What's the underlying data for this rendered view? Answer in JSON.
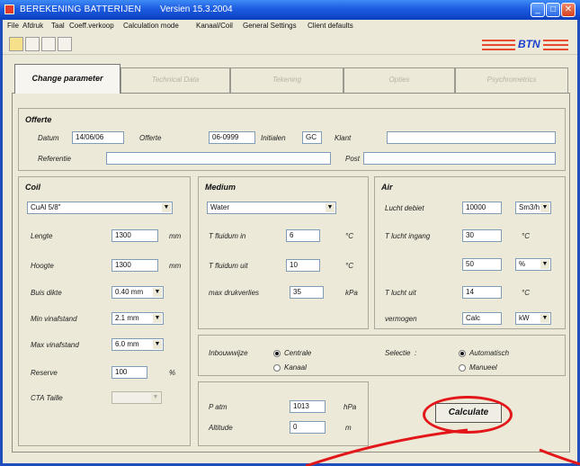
{
  "window": {
    "title": "BEREKENING BATTERIJEN",
    "version": "Versien 15.3.2004",
    "btn_min": "_",
    "btn_max": "□",
    "btn_close": "✕"
  },
  "menu": [
    "File",
    "Afdruk",
    "Taal",
    "Coeff.verkoop",
    "Calculation mode",
    "Kanaal/Coil",
    "General Settings",
    "Client defaults"
  ],
  "logo": "BTN",
  "tabs": [
    "Change parameter",
    "Technical Data",
    "Tekening",
    "Opties",
    "Psychrometrics"
  ],
  "offerte": {
    "title": "Offerte",
    "datum_label": "Datum",
    "datum_value": "14/06/06",
    "offerte_label": "Offerte",
    "offerte_value": "06-0999",
    "initialen_label": "Initialen",
    "initialen_value": "GC",
    "klant_label": "Klant",
    "klant_value": "",
    "referentie_label": "Referentie",
    "referentie_value": "",
    "post_label": "Post",
    "post_value": ""
  },
  "coil": {
    "title": "Coil",
    "type_value": "CuAl 5/8\"",
    "lengte_label": "Lengte",
    "lengte_value": "1300",
    "lengte_unit": "mm",
    "hoogte_label": "Hoogte",
    "hoogte_value": "1300",
    "hoogte_unit": "mm",
    "buis_label": "Buis dikte",
    "buis_value": "0.40 mm",
    "vin_label": "Min vinafstand",
    "vin_value": "2.1 mm",
    "max_label": "Max vinafstand",
    "max_value": "6.0 mm",
    "reserve_label": "Reserve",
    "reserve_value": "100",
    "reserve_unit": "%",
    "cta_label": "CTA Taille",
    "cta_value": ""
  },
  "medium": {
    "title": "Medium",
    "type_value": "Water",
    "tin_label": "T fluidum in",
    "tin_value": "6",
    "tin_unit": "°C",
    "tout_label": "T fluidum uit",
    "tout_value": "10",
    "tout_unit": "°C",
    "dp_label": "max drukverlies",
    "dp_value": "35",
    "dp_unit": "kPa"
  },
  "air": {
    "title": "Air",
    "debiet_label": "Lucht debiet",
    "debiet_value": "10000",
    "debiet_unit": "Sm3/h",
    "tin_label": "T lucht ingang",
    "tin_value": "30",
    "tin_unit": "°C",
    "rh_value": "50",
    "rh_unit": "%",
    "tout_label": "T lucht uit",
    "tout_value": "14",
    "tout_unit": "°C",
    "verm_label": "vermogen",
    "verm_value": "Calc",
    "verm_unit": "kW"
  },
  "inbouw": {
    "label": "Inbouwwijze",
    "opt1": "Centrale",
    "opt2": "Kanaal",
    "selected": "Centrale"
  },
  "selectie": {
    "label": "Selectie",
    "opt1": "Automatisch",
    "opt2": "Manueel",
    "selected": "Automatisch"
  },
  "ambient": {
    "patm_label": "P atm",
    "patm_value": "1013",
    "patm_unit": "hPa",
    "alt_label": "Altitude",
    "alt_value": "0",
    "alt_unit": "m"
  },
  "calculate_label": "Calculate",
  "colors": {
    "title_blue": "#1d5be0",
    "annotation_red": "#e3161a",
    "logo_blue": "#1a3fd0"
  }
}
